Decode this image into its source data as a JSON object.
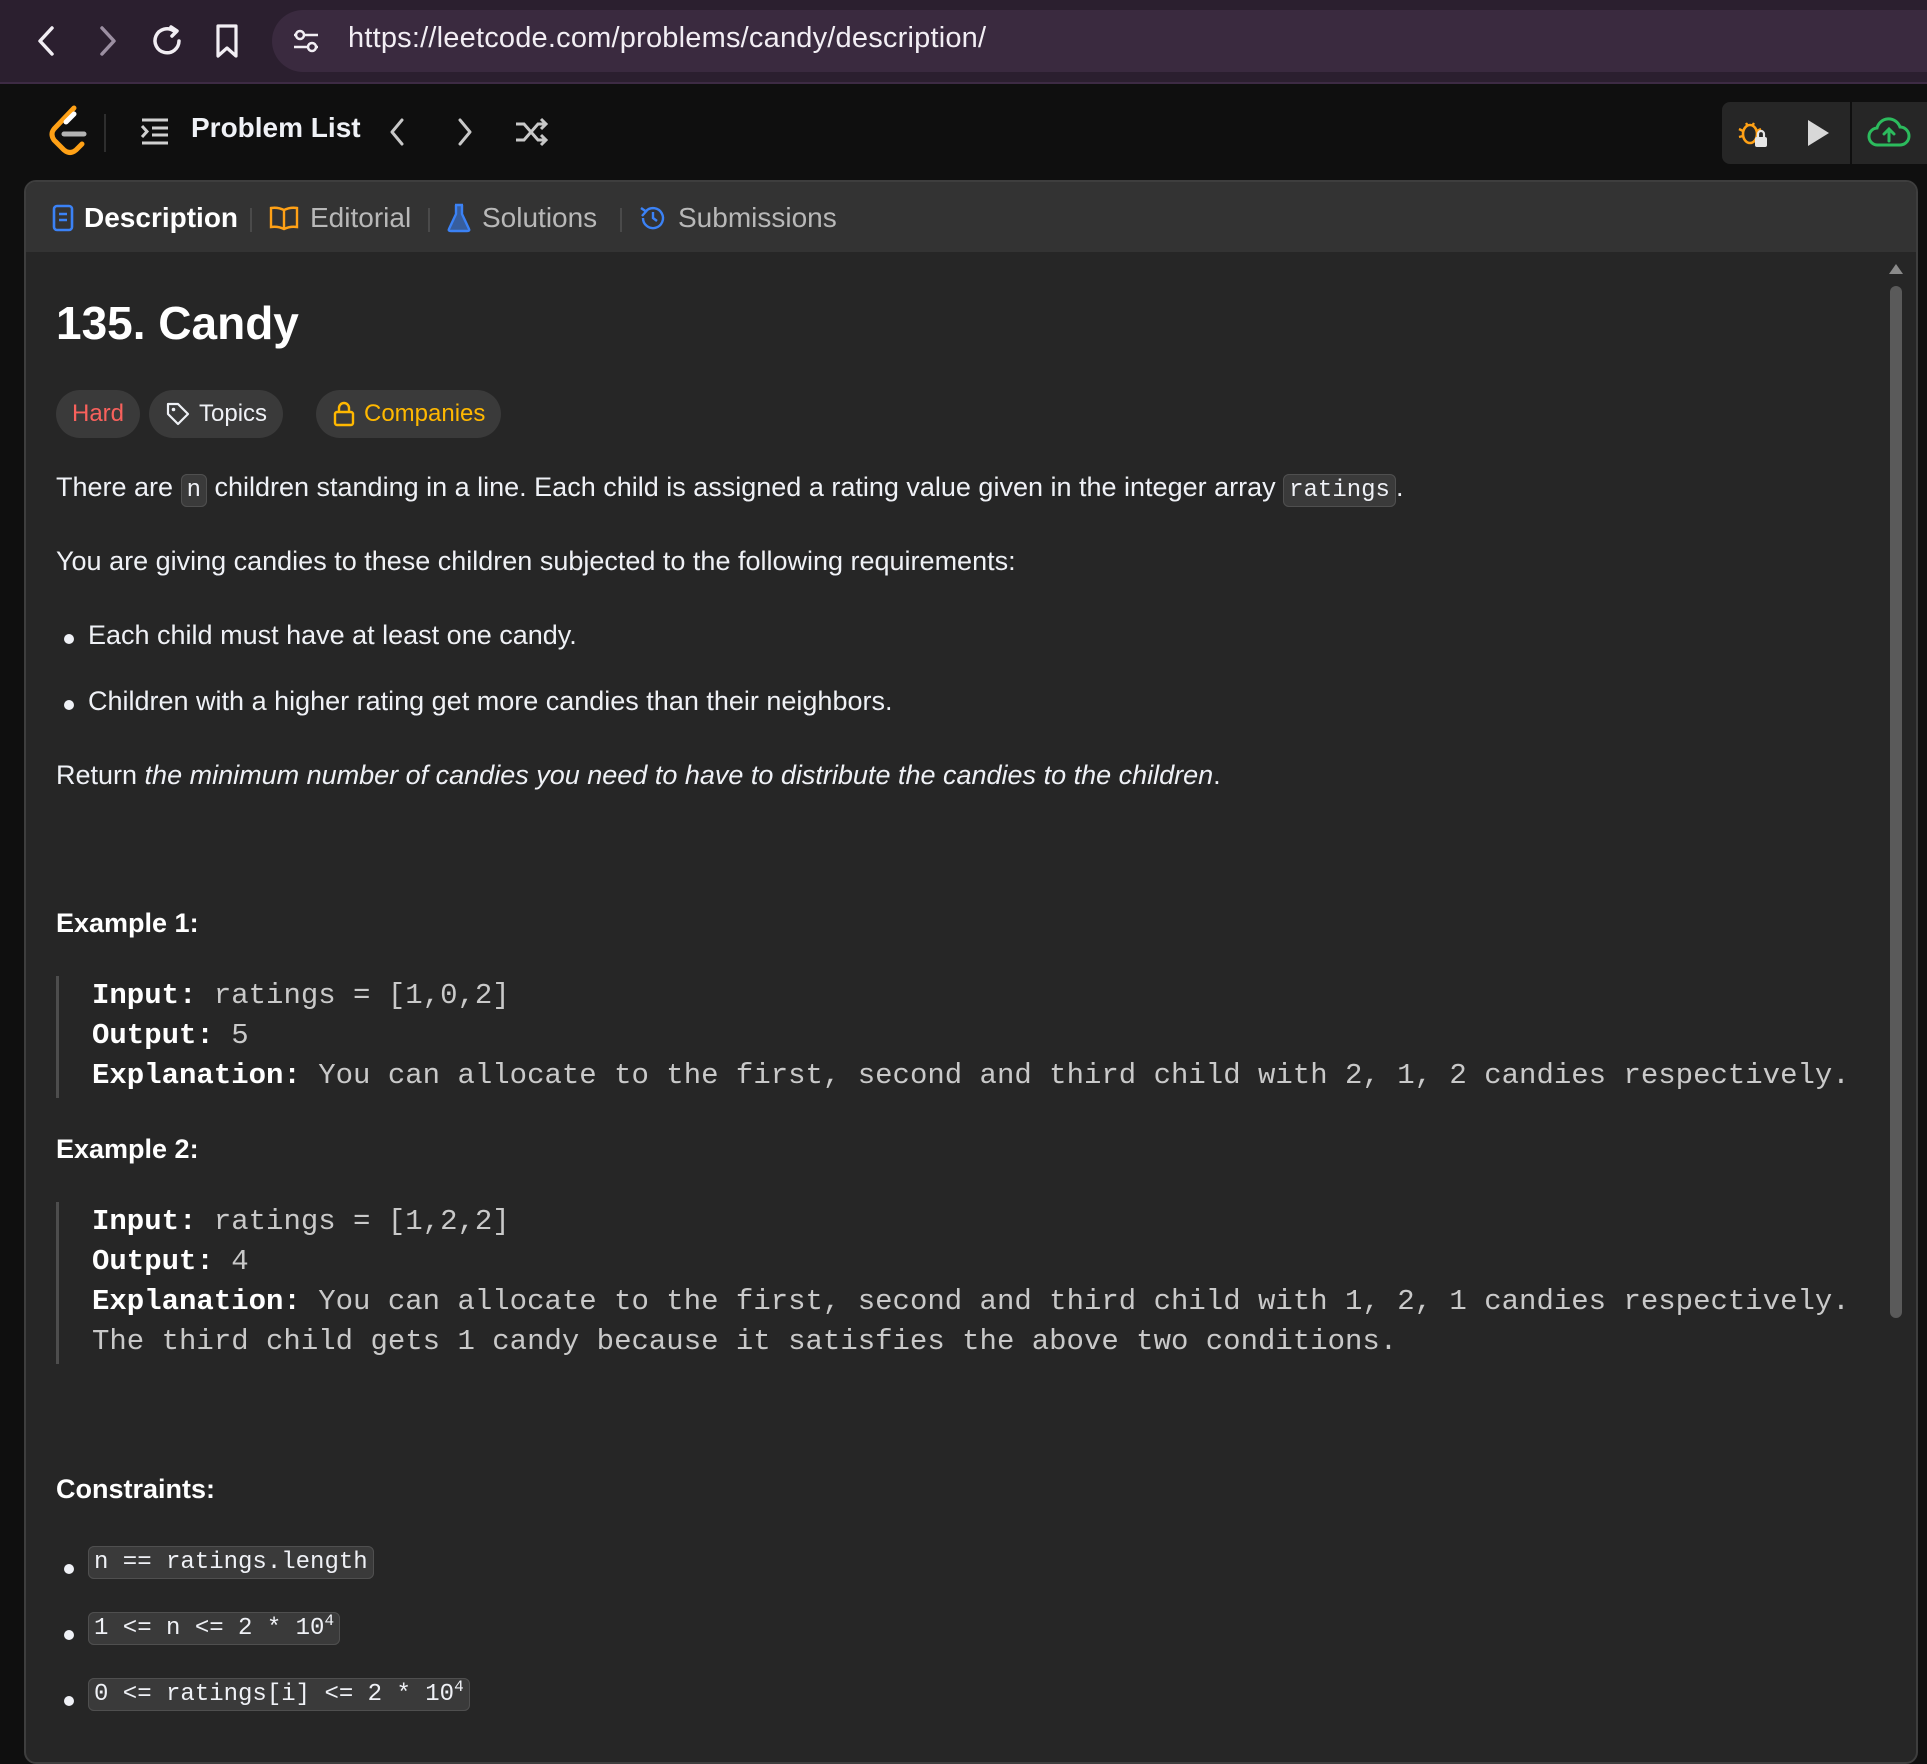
{
  "browser": {
    "url": "https://leetcode.com/problems/candy/description/"
  },
  "nav": {
    "problem_list_label": "Problem List"
  },
  "tabs": [
    {
      "label": "Description",
      "active": true
    },
    {
      "label": "Editorial",
      "active": false
    },
    {
      "label": "Solutions",
      "active": false
    },
    {
      "label": "Submissions",
      "active": false
    }
  ],
  "problem": {
    "title": "135. Candy",
    "badges": {
      "difficulty": "Hard",
      "topics": "Topics",
      "companies": "Companies"
    },
    "intro": {
      "part1": "There are ",
      "code_n": "n",
      "part2": " children standing in a line. Each child is assigned a rating value given in the integer array ",
      "code_ratings": "ratings",
      "part3": "."
    },
    "requirements_intro": "You are giving candies to these children subjected to the following requirements:",
    "requirements": [
      "Each child must have at least one candy.",
      "Children with a higher rating get more candies than their neighbors."
    ],
    "return": {
      "prefix": "Return ",
      "italic": "the minimum number of candies you need to have to distribute the candies to the children",
      "suffix": "."
    },
    "examples": [
      {
        "heading": "Example 1:",
        "input_label": "Input:",
        "input": "ratings = [1,0,2]",
        "output_label": "Output:",
        "output": "5",
        "explanation_label": "Explanation:",
        "explanation": "You can allocate to the first, second and third child with 2, 1, 2 candies respectively.",
        "explanation2": ""
      },
      {
        "heading": "Example 2:",
        "input_label": "Input:",
        "input": "ratings = [1,2,2]",
        "output_label": "Output:",
        "output": "4",
        "explanation_label": "Explanation:",
        "explanation": "You can allocate to the first, second and third child with 1, 2, 1 candies respectively.",
        "explanation2": "The third child gets 1 candy because it satisfies the above two conditions."
      }
    ],
    "constraints_heading": "Constraints:",
    "constraints": [
      {
        "text": "n == ratings.length",
        "sup": ""
      },
      {
        "text": "1 <= n <= 2 * 10",
        "sup": "4"
      },
      {
        "text": "0 <= ratings[i] <= 2 * 10",
        "sup": "4"
      }
    ]
  },
  "colors": {
    "hard": "#f8615c",
    "companies": "#ffb800",
    "tab_icon_blue": "#3b82f6",
    "submit_green": "#2cbb5d",
    "logo_orange": "#ffa116"
  }
}
